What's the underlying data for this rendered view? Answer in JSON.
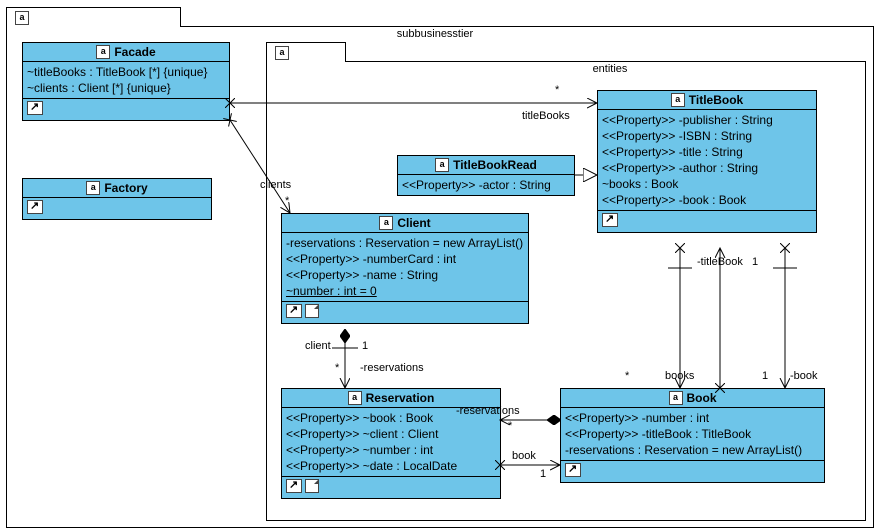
{
  "outer": {
    "tab": "a",
    "name": "subbusinesstier"
  },
  "inner": {
    "tab": "a",
    "name": "entities"
  },
  "facade": {
    "name": "Facade",
    "attrs": [
      "~titleBooks : TitleBook [*] {unique}",
      "~clients : Client [*] {unique}"
    ]
  },
  "factory": {
    "name": "Factory"
  },
  "titlebookread": {
    "name": "TitleBookRead",
    "attrs": [
      "<<Property>> -actor : String"
    ]
  },
  "client": {
    "name": "Client",
    "attrs": [
      "-reservations : Reservation = new ArrayList()",
      "<<Property>> -numberCard : int",
      "<<Property>> -name : String"
    ],
    "static_attr": "~number : int = 0"
  },
  "titlebook": {
    "name": "TitleBook",
    "attrs": [
      "<<Property>> -publisher : String",
      "<<Property>> -ISBN : String",
      "<<Property>> -title : String",
      "<<Property>> -author : String",
      "~books : Book",
      "<<Property>> -book : Book"
    ]
  },
  "reservation": {
    "name": "Reservation",
    "attrs": [
      "<<Property>> ~book : Book",
      "<<Property>> ~client : Client",
      "<<Property>> ~number : int",
      "<<Property>> ~date : LocalDate"
    ]
  },
  "book": {
    "name": "Book",
    "attrs": [
      "<<Property>> -number : int",
      "<<Property>> -titleBook : TitleBook",
      "-reservations : Reservation = new ArrayList()"
    ]
  },
  "rel": {
    "titleBooks_role": "titleBooks",
    "titleBooks_m": "*",
    "clients_role": "clients",
    "clients_m": "*",
    "client_role": "client",
    "client_m": "1",
    "reservations_role": "-reservations",
    "reservations_m": "*",
    "reservations2_role": "-reservations",
    "reservations2_m": "*",
    "book_role": "book",
    "book_m": "1",
    "bookrole2": "-book",
    "bookm2": "1",
    "books_role": "books",
    "books_m": "*",
    "titleBook_role": "-titleBook",
    "titleBook_m": "1"
  }
}
